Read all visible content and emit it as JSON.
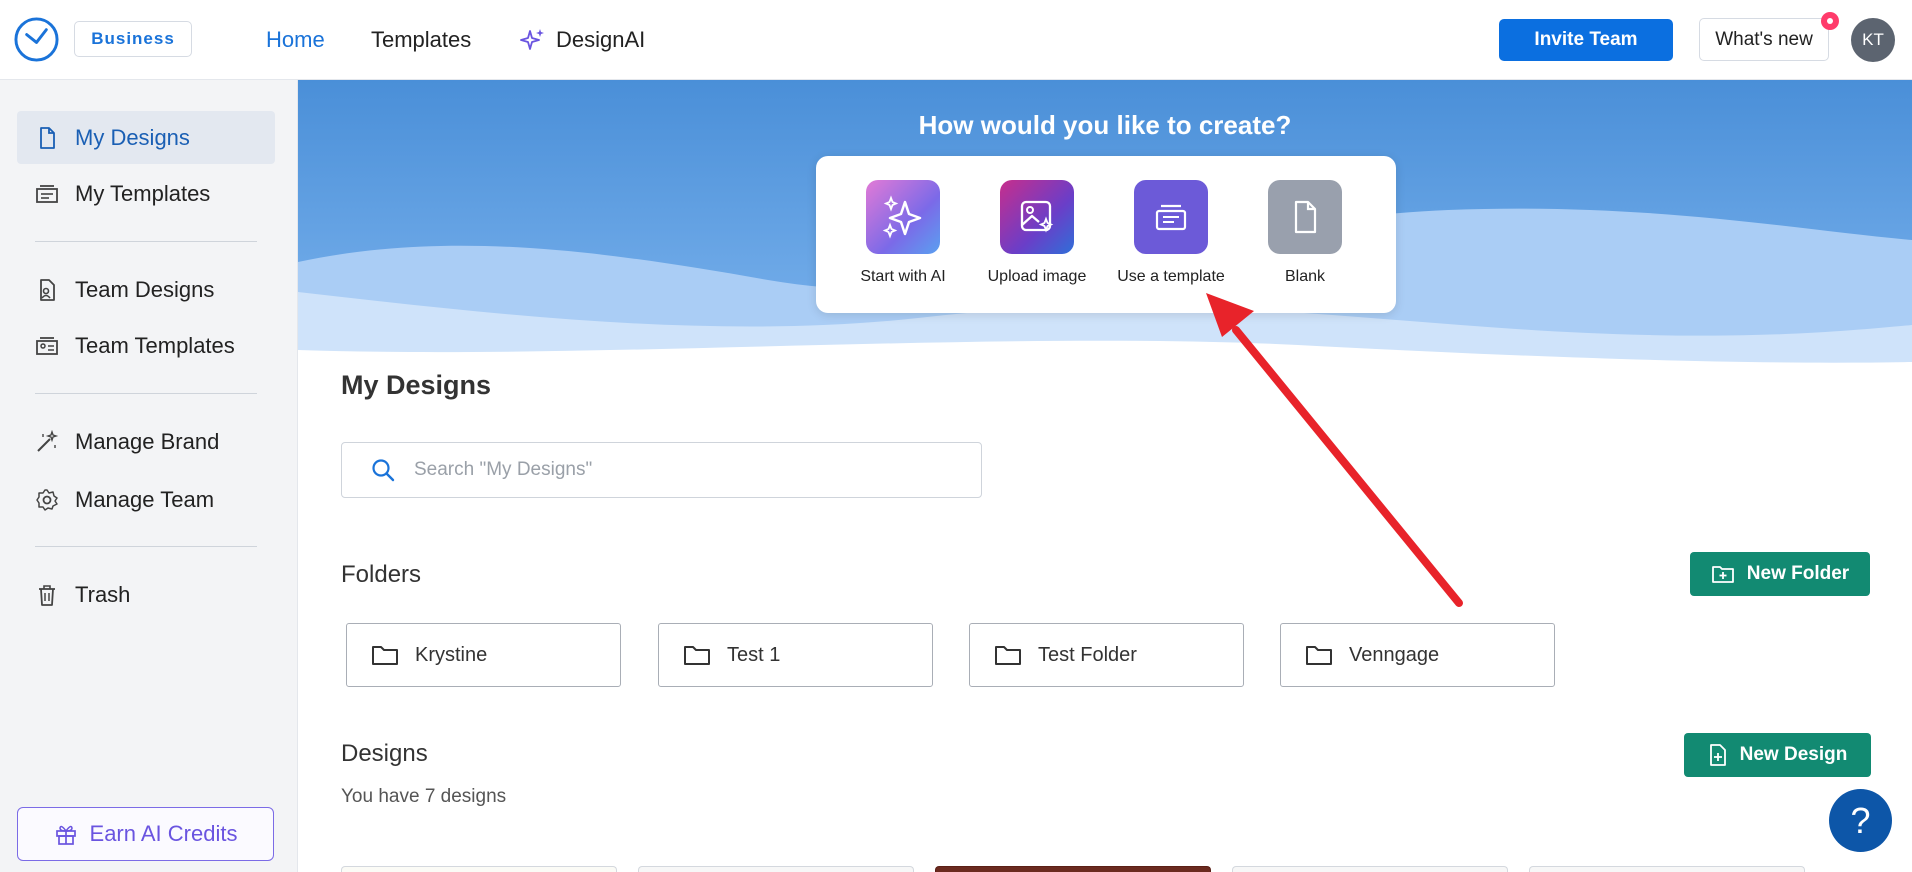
{
  "header": {
    "plan_badge": "Business",
    "nav": {
      "home": "Home",
      "templates": "Templates",
      "designai": "DesignAI"
    },
    "invite_label": "Invite Team",
    "whatsnew_label": "What's new",
    "avatar_initials": "KT"
  },
  "sidebar": {
    "items": [
      {
        "label": "My Designs",
        "icon": "document-icon",
        "active": true
      },
      {
        "label": "My Templates",
        "icon": "template-icon"
      },
      {
        "label": "Team Designs",
        "icon": "team-document-icon"
      },
      {
        "label": "Team Templates",
        "icon": "team-template-icon"
      },
      {
        "label": "Manage Brand",
        "icon": "magic-wand-icon"
      },
      {
        "label": "Manage Team",
        "icon": "gear-icon"
      },
      {
        "label": "Trash",
        "icon": "trash-icon"
      }
    ],
    "earn_label": "Earn AI Credits"
  },
  "hero": {
    "title": "How would you like to create?",
    "options": [
      {
        "label": "Start with AI",
        "icon": "sparkle-icon"
      },
      {
        "label": "Upload image",
        "icon": "image-upload-icon"
      },
      {
        "label": "Use a template",
        "icon": "template-icon"
      },
      {
        "label": "Blank",
        "icon": "blank-page-icon"
      }
    ]
  },
  "main": {
    "title": "My Designs",
    "search_placeholder": "Search \"My Designs\"",
    "folders_heading": "Folders",
    "new_folder_label": "New Folder",
    "folders": [
      "Krystine",
      "Test 1",
      "Test Folder",
      "Venngage"
    ],
    "designs_heading": "Designs",
    "new_design_label": "New Design",
    "designs_count": "You have 7 designs"
  },
  "help_label": "?",
  "colors": {
    "primary_blue": "#0b6fe0",
    "green": "#128a72",
    "annotation_red": "#e8232a",
    "earn_purple": "#6a54e0"
  }
}
